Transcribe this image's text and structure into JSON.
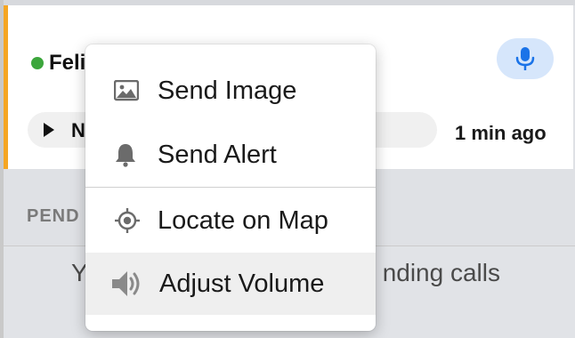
{
  "card": {
    "contact_name": "Feli",
    "play_label": "N",
    "timestamp": "1 min ago",
    "status_color": "#3ca63c",
    "accent_color": "#f5a623",
    "mic_color": "#1a73e8"
  },
  "pending": {
    "header": "PEND",
    "message_left": "Y",
    "message_right": "nding calls"
  },
  "menu": {
    "items": [
      {
        "label": "Send Image",
        "icon": "image-icon"
      },
      {
        "label": "Send Alert",
        "icon": "bell-icon"
      },
      {
        "label": "Locate on Map",
        "icon": "locate-icon"
      },
      {
        "label": "Adjust Volume",
        "icon": "volume-icon",
        "highlighted": true
      }
    ]
  }
}
